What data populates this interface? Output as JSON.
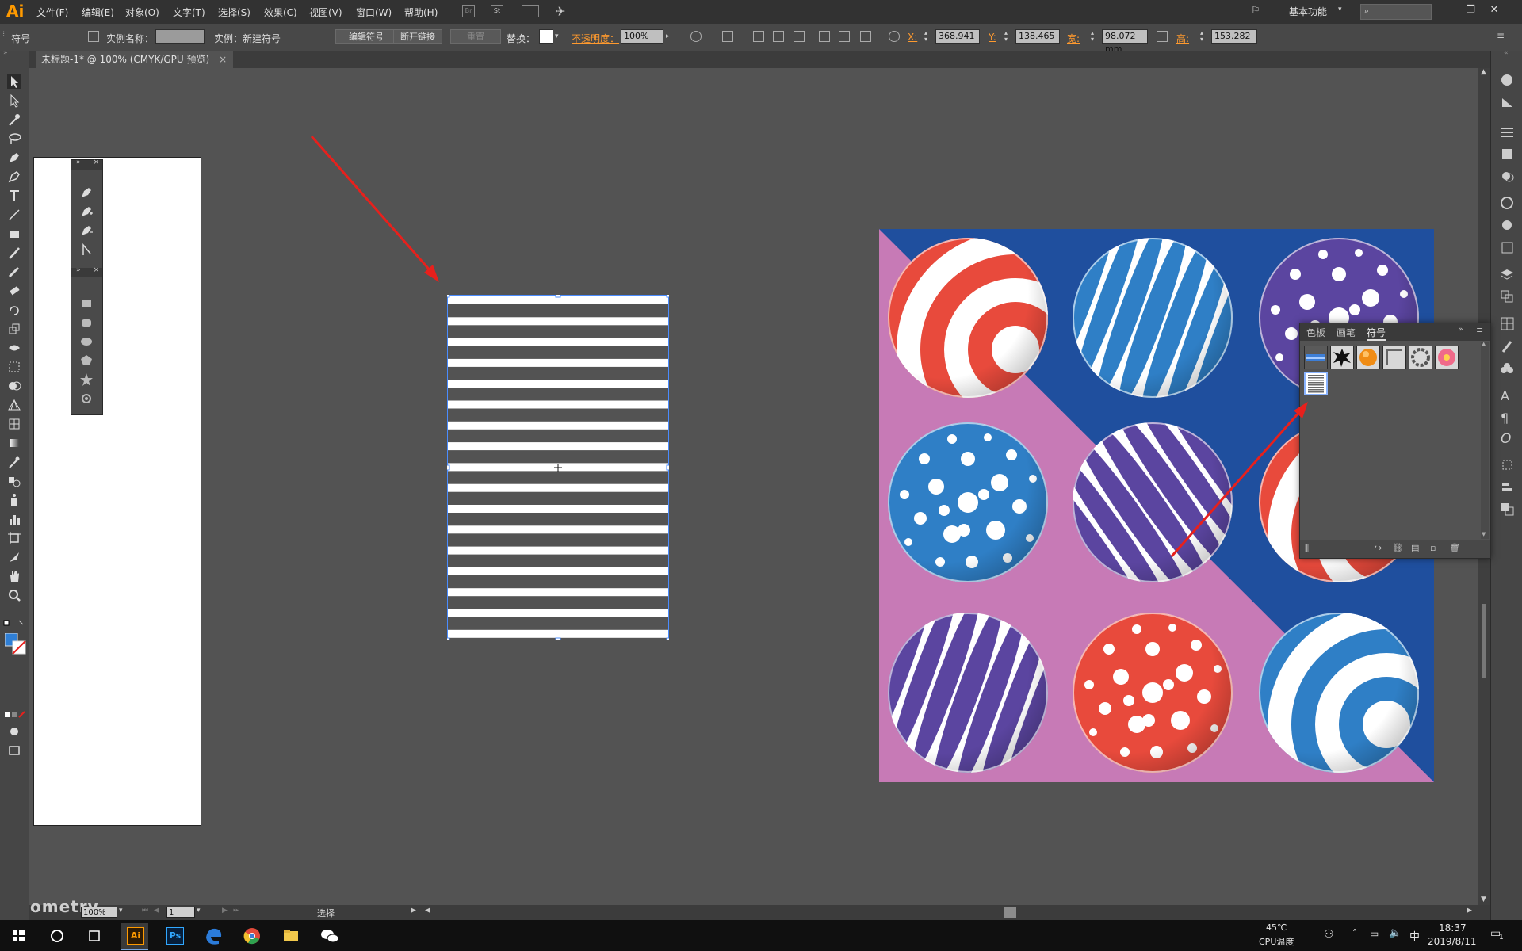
{
  "app": {
    "logo": "Ai"
  },
  "menubar": {
    "items": [
      "文件(F)",
      "编辑(E)",
      "对象(O)",
      "文字(T)",
      "选择(S)",
      "效果(C)",
      "视图(V)",
      "窗口(W)",
      "帮助(H)"
    ],
    "br_label": "Br",
    "st_label": "St",
    "workspace": "基本功能",
    "window_controls": [
      "—",
      "❐",
      "✕"
    ]
  },
  "controlbar": {
    "object_type": "符号",
    "instance_name_label": "实例名称：",
    "instance_label": "实例：新建符号",
    "edit_symbol": "编辑符号",
    "break_link": "断开链接",
    "reset": "重置",
    "replace_label": "替换：",
    "opacity_label": "不透明度：",
    "opacity_value": "100%",
    "x_label": "X:",
    "x_value": "368.941",
    "y_label": "Y:",
    "y_value": "138.465",
    "w_label": "宽:",
    "w_value": "98.072 mm",
    "h_label": "高:",
    "h_value": "153.282"
  },
  "tab": {
    "title": "未标题-1* @ 100% (CMYK/GPU 预览)",
    "close": "×"
  },
  "symbols_panel": {
    "tabs": [
      "色板",
      "画笔",
      "符号"
    ],
    "active_tab": "符号",
    "symbols": [
      "blue-banner",
      "black-splat",
      "orange-ball",
      "corner-frame",
      "gray-ring",
      "pink-flower",
      "new-stripe-symbol"
    ]
  },
  "statusbar": {
    "zoom": "100%",
    "page": "1",
    "tool": "选择",
    "watermark": "ometry"
  },
  "taskbar": {
    "apps": [
      "windows-start",
      "cortana",
      "task-view",
      "illustrator",
      "photoshop",
      "edge",
      "chrome",
      "file-explorer",
      "wechat"
    ],
    "ai_label": "Ai",
    "ps_label": "Ps",
    "cpu_temp": "45℃",
    "cpu_label": "CPU温度",
    "ime": "中",
    "time": "18:37",
    "date": "2019/8/11",
    "notification": "1"
  },
  "colors": {
    "accent_orange": "#ff9a00",
    "red_arrow": "#e8201c",
    "pattern_blue": "#1f4f9e",
    "pattern_pink": "#c77ab6",
    "ball_red": "#e84a3c",
    "ball_blue": "#2f7fc6",
    "ball_purple": "#5b45a0"
  }
}
